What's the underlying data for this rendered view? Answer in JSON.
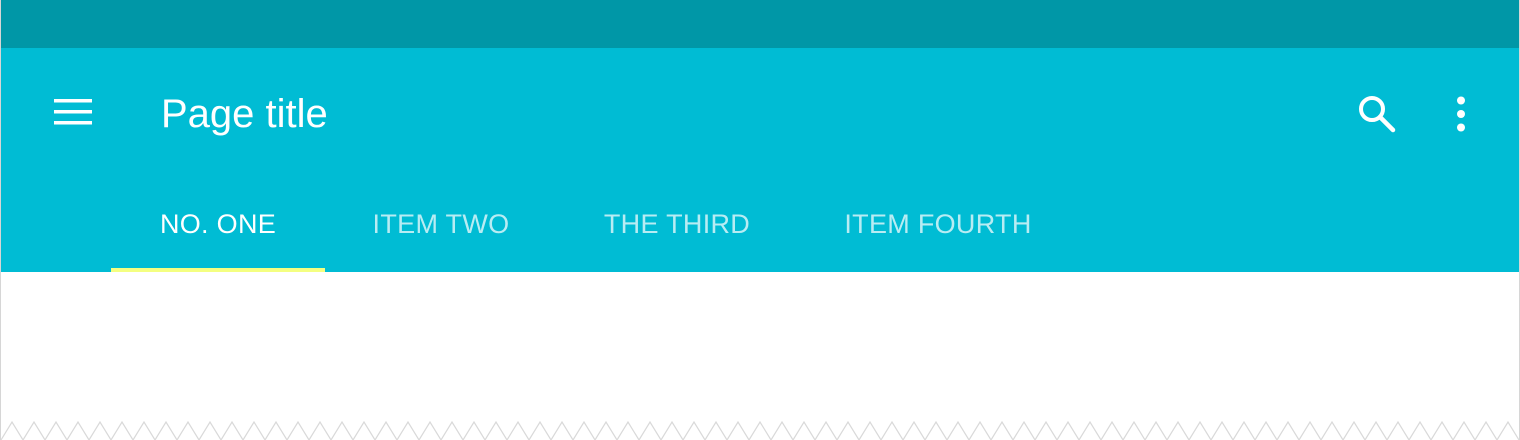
{
  "colors": {
    "status_bar": "#0097a7",
    "app_bar": "#00bcd4",
    "tab_indicator": "#f4ff81",
    "text_primary": "#ffffff"
  },
  "status_bar": {},
  "app_bar": {
    "nav_icon": "menu-icon",
    "title": "Page title",
    "actions": [
      {
        "icon": "search-icon"
      },
      {
        "icon": "more-vert-icon"
      }
    ]
  },
  "tabs": [
    {
      "label": "NO. ONE",
      "active": true
    },
    {
      "label": "ITEM TWO",
      "active": false
    },
    {
      "label": "THE THIRD",
      "active": false
    },
    {
      "label": "ITEM FOURTH",
      "active": false
    }
  ]
}
